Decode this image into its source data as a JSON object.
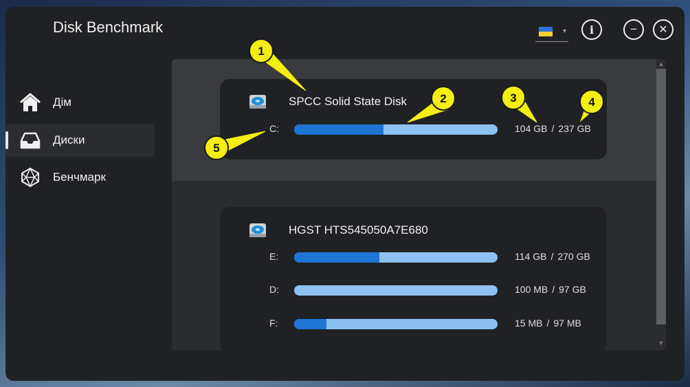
{
  "app": {
    "title": "Disk Benchmark"
  },
  "language": {
    "flag": "ukraine-flag",
    "colors": [
      "#2f6fd6",
      "#f2d22e"
    ]
  },
  "titlebar": {
    "info_icon": "i",
    "minimize_icon": "−",
    "close_icon": "✕"
  },
  "sidebar": {
    "items": [
      {
        "label": "Дім",
        "icon": "home-icon",
        "active": false
      },
      {
        "label": "Диски",
        "icon": "inbox-tray-icon",
        "active": true
      },
      {
        "label": "Бенчмарк",
        "icon": "polyhedron-icon",
        "active": false
      }
    ]
  },
  "disks": [
    {
      "name": "SPCC Solid State Disk",
      "selected": true,
      "partitions": [
        {
          "letter": "C:",
          "used": "104 GB",
          "total": "237 GB",
          "used_fraction": 0.44
        }
      ]
    },
    {
      "name": "HGST HTS545050A7E680",
      "selected": false,
      "partitions": [
        {
          "letter": "E:",
          "used": "114 GB",
          "total": "270 GB",
          "used_fraction": 0.42
        },
        {
          "letter": "D:",
          "used": "100 MB",
          "total": "97 GB",
          "used_fraction": 0.0
        },
        {
          "letter": "F:",
          "used": "15 MB",
          "total": "97 MB",
          "used_fraction": 0.16
        }
      ]
    }
  ],
  "size_separator": "/",
  "callouts": [
    "1",
    "2",
    "3",
    "4",
    "5"
  ],
  "colors": {
    "accent": "#1f75d4",
    "bar_bg": "#8cc1f2",
    "callout_fill": "#f5ee12"
  }
}
